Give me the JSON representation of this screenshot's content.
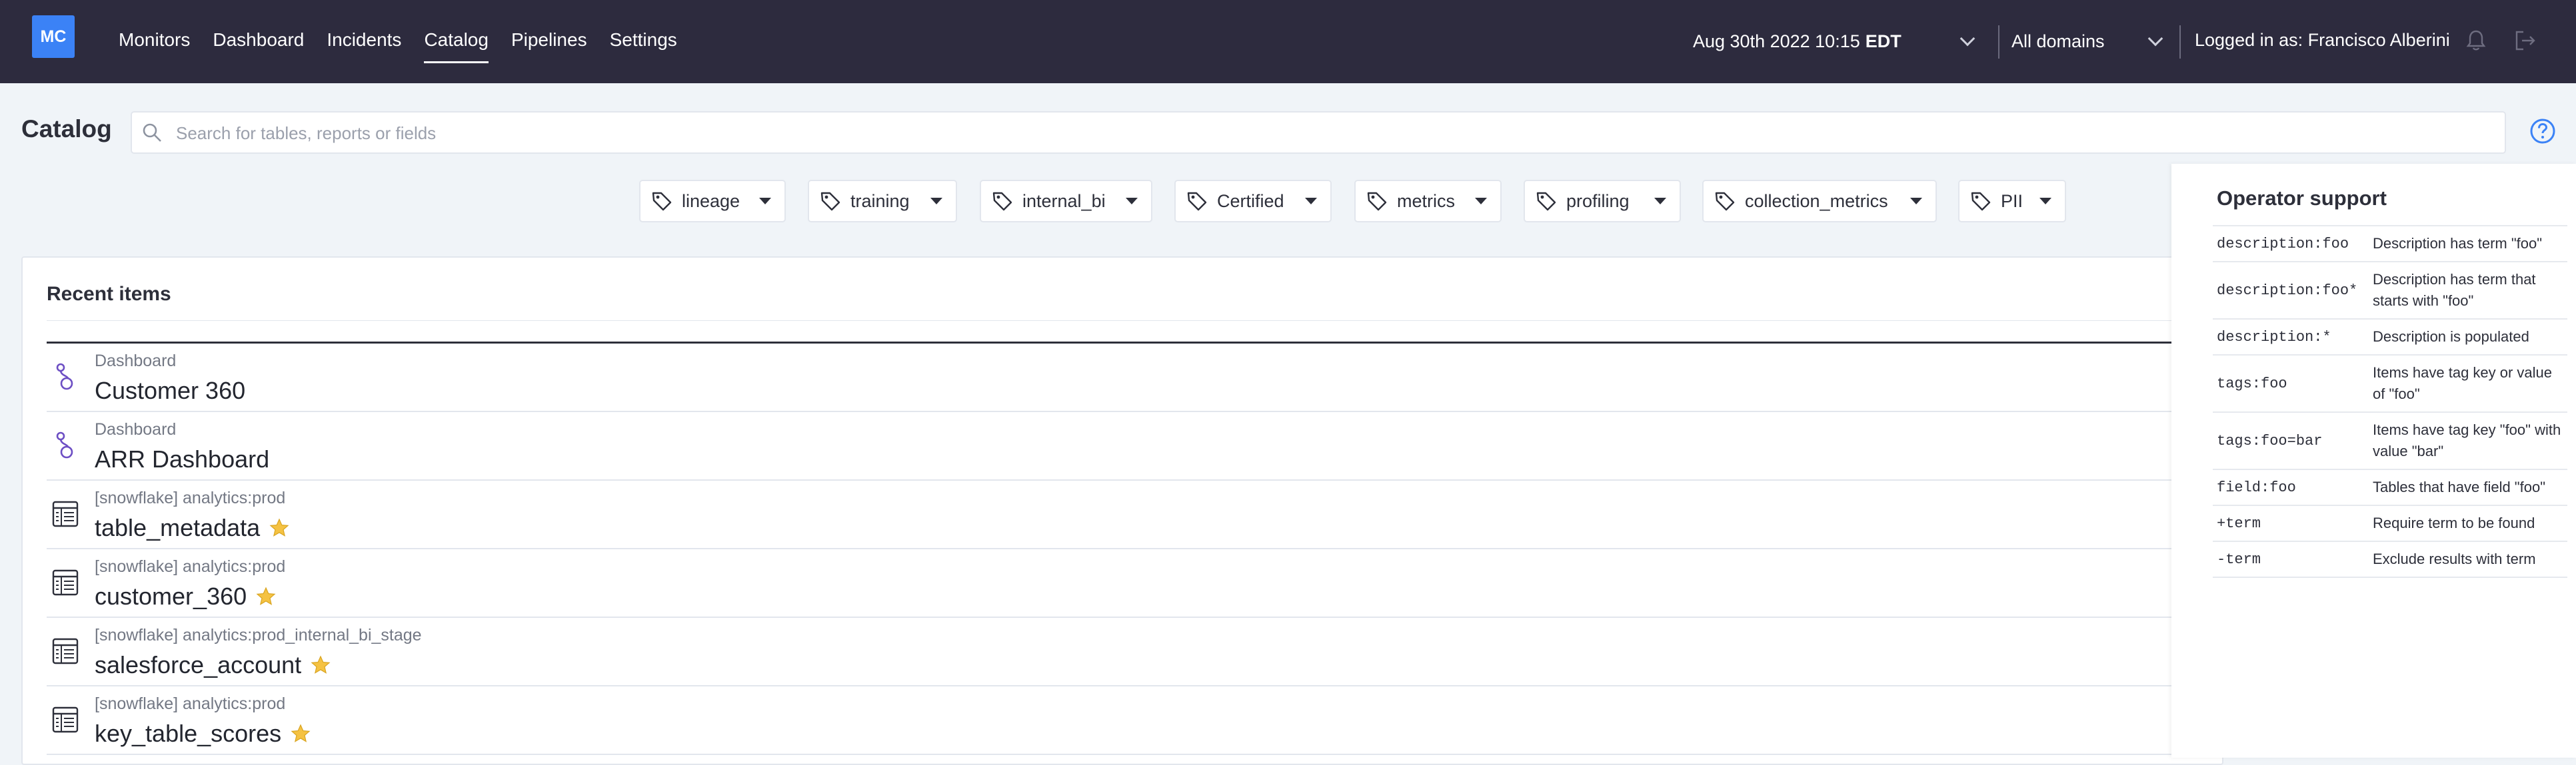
{
  "header": {
    "logo_text": "MC",
    "nav": [
      "Monitors",
      "Dashboard",
      "Incidents",
      "Catalog",
      "Pipelines",
      "Settings"
    ],
    "active_nav": "Catalog",
    "date": "Aug 30th 2022 10:15",
    "timezone": "EDT",
    "domain": "All domains",
    "login": "Logged in as: Francisco Alberini"
  },
  "catalog": {
    "title": "Catalog",
    "search_placeholder": "Search for tables, reports or fields"
  },
  "tags": [
    "lineage",
    "training",
    "internal_bi",
    "Certified",
    "metrics",
    "profiling",
    "collection_metrics",
    "PII"
  ],
  "recent": {
    "title": "Recent items",
    "items": [
      {
        "kind": "Dashboard",
        "name": "Customer 360",
        "icon": "dashboard-icon",
        "starred": false
      },
      {
        "kind": "Dashboard",
        "name": "ARR Dashboard",
        "icon": "dashboard-icon",
        "starred": false
      },
      {
        "kind": "[snowflake] analytics:prod",
        "name": "table_metadata",
        "icon": "table-icon",
        "starred": true
      },
      {
        "kind": "[snowflake] analytics:prod",
        "name": "customer_360",
        "icon": "table-icon",
        "starred": true
      },
      {
        "kind": "[snowflake] analytics:prod_internal_bi_stage",
        "name": "salesforce_account",
        "icon": "table-icon",
        "starred": true
      },
      {
        "kind": "[snowflake] analytics:prod",
        "name": "key_table_scores",
        "icon": "table-icon",
        "starred": true
      }
    ]
  },
  "operators": {
    "title": "Operator support",
    "rows": [
      {
        "code": "description:foo",
        "desc": "Description has term \"foo\""
      },
      {
        "code": "description:foo*",
        "desc": "Description has term that starts with \"foo\""
      },
      {
        "code": "description:*",
        "desc": "Description is populated"
      },
      {
        "code": "tags:foo",
        "desc": "Items have tag key or value of \"foo\""
      },
      {
        "code": "tags:foo=bar",
        "desc": "Items have tag key \"foo\" with value \"bar\""
      },
      {
        "code": "field:foo",
        "desc": "Tables that have field \"foo\""
      },
      {
        "code": "+term",
        "desc": "Require term to be found"
      },
      {
        "code": "-term",
        "desc": "Exclude results with term"
      }
    ]
  },
  "colors": {
    "topbar": "#2d2b3e",
    "logo": "#3b82f6",
    "star": "#f5c242",
    "dashboard_icon": "#6d4fc4"
  }
}
